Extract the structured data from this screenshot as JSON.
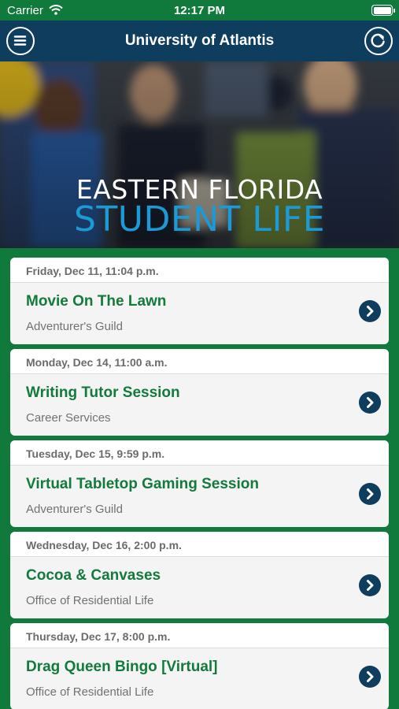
{
  "status_bar": {
    "carrier": "Carrier",
    "time": "12:17 PM"
  },
  "nav": {
    "title": "University of Atlantis",
    "left_icon": "menu-icon",
    "right_icon": "refresh-icon"
  },
  "banner": {
    "line1": "EASTERN FLORIDA",
    "line2": "STUDENT LIFE"
  },
  "events": [
    {
      "date": "Friday, Dec 11, 11:04 p.m.",
      "title": "Movie On The Lawn",
      "organizer": "Adventurer's Guild"
    },
    {
      "date": "Monday, Dec 14, 11:00 a.m.",
      "title": "Writing Tutor Session",
      "organizer": "Career Services"
    },
    {
      "date": "Tuesday, Dec 15, 9:59 p.m.",
      "title": "Virtual Tabletop Gaming Session",
      "organizer": "Adventurer's Guild"
    },
    {
      "date": "Wednesday, Dec 16, 2:00 p.m.",
      "title": "Cocoa & Canvases",
      "organizer": "Office of Residential Life"
    },
    {
      "date": "Thursday, Dec 17, 8:00 p.m.",
      "title": "Drag Queen Bingo [Virtual]",
      "organizer": "Office of Residential Life"
    }
  ],
  "colors": {
    "accent_green": "#0f7a3c",
    "nav_blue": "#0e3d5e",
    "title_green": "#137a3c",
    "banner_blue": "#1b9ad6"
  }
}
